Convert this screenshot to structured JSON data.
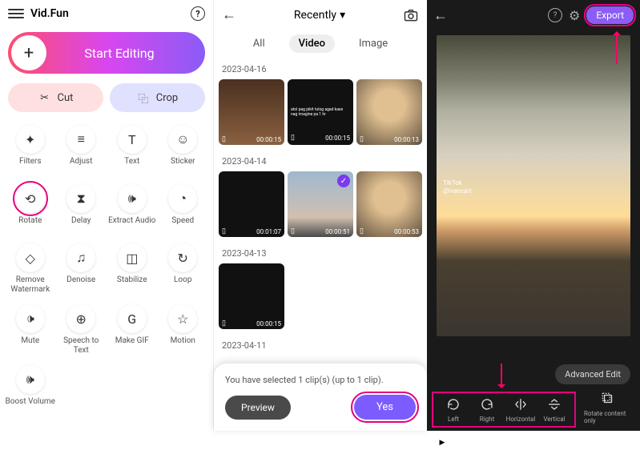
{
  "panel1": {
    "app_title": "Vid.Fun",
    "start_label": "Start Editing",
    "cut_label": "Cut",
    "crop_label": "Crop",
    "tools": [
      {
        "label": "Filters",
        "icon": "✦"
      },
      {
        "label": "Adjust",
        "icon": "≡"
      },
      {
        "label": "Text",
        "icon": "T"
      },
      {
        "label": "Sticker",
        "icon": "☺"
      },
      {
        "label": "Rotate",
        "icon": "⟲",
        "highlight": true
      },
      {
        "label": "Delay",
        "icon": "⧗"
      },
      {
        "label": "Extract Audio",
        "icon": "🕪"
      },
      {
        "label": "Speed",
        "icon": "◔"
      },
      {
        "label": "Remove Watermark",
        "icon": "◇"
      },
      {
        "label": "Denoise",
        "icon": "♫"
      },
      {
        "label": "Stabilize",
        "icon": "◫"
      },
      {
        "label": "Loop",
        "icon": "↻"
      },
      {
        "label": "Mute",
        "icon": "🕩"
      },
      {
        "label": "Speech to Text",
        "icon": "⊕"
      },
      {
        "label": "Make GIF",
        "icon": "G"
      },
      {
        "label": "Motion",
        "icon": "☆"
      },
      {
        "label": "Boost Volume",
        "icon": "🕪"
      }
    ]
  },
  "panel2": {
    "title": "Recently",
    "tabs": {
      "all": "All",
      "video": "Video",
      "image": "Image"
    },
    "groups": [
      {
        "date": "2023-04-16",
        "clips": [
          {
            "dur": "00:00:15"
          },
          {
            "dur": "00:00:15",
            "text": "atol pag pikit tulog agad kase nag imagine pa 1 hr"
          },
          {
            "dur": "00:00:13"
          }
        ]
      },
      {
        "date": "2023-04-14",
        "clips": [
          {
            "dur": "00:01:07"
          },
          {
            "dur": "00:00:51",
            "checked": true
          },
          {
            "dur": "00:00:53"
          }
        ]
      },
      {
        "date": "2023-04-13",
        "clips": [
          {
            "dur": "00:00:15"
          }
        ]
      },
      {
        "date": "2023-04-11",
        "clips": []
      }
    ],
    "selection_text": "You have selected 1 clip(s) (up to 1 clip).",
    "preview_label": "Preview",
    "yes_label": "Yes"
  },
  "panel3": {
    "export_label": "Export",
    "tiktok": "TikTok\n@lvancart",
    "advanced_label": "Advanced Edit",
    "rotate_tools": [
      {
        "label": "Left"
      },
      {
        "label": "Right"
      },
      {
        "label": "Horizontal"
      },
      {
        "label": "Vertical"
      }
    ],
    "rotate_only_label": "Rotate content only"
  }
}
